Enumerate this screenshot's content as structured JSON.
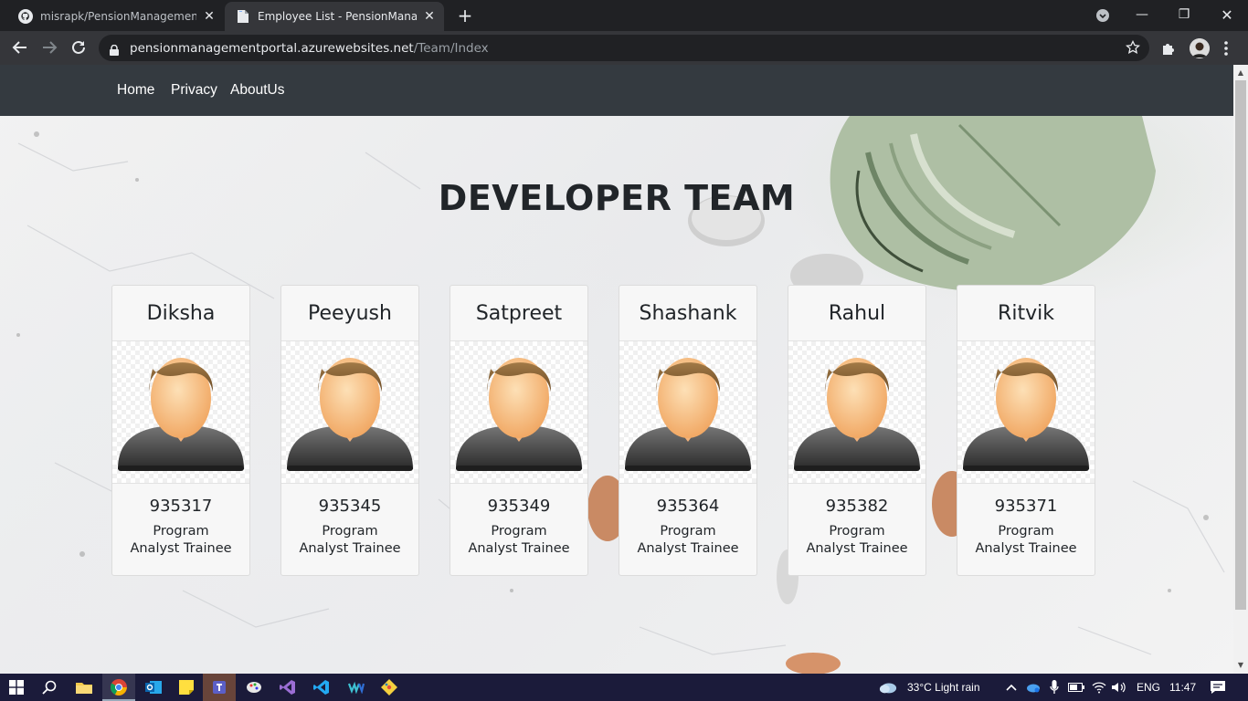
{
  "browser": {
    "tabs": [
      {
        "label": "misrapk/PensionManagement-Po",
        "active": false,
        "icon": "github-icon"
      },
      {
        "label": "Employee List - PensionManagem",
        "active": true,
        "icon": "document-icon"
      }
    ],
    "url_host": "pensionmanagementportal.azurewebsites.net",
    "url_path": "/Team/Index"
  },
  "nav": {
    "links": [
      "Home",
      "Privacy",
      "AboutUs"
    ]
  },
  "page": {
    "title": "DEVELOPER TEAM"
  },
  "team": [
    {
      "name": "Diksha",
      "id": "935317",
      "role_line1": "Program",
      "role_line2": "Analyst Trainee"
    },
    {
      "name": "Peeyush",
      "id": "935345",
      "role_line1": "Program",
      "role_line2": "Analyst Trainee"
    },
    {
      "name": "Satpreet",
      "id": "935349",
      "role_line1": "Program",
      "role_line2": "Analyst Trainee"
    },
    {
      "name": "Shashank",
      "id": "935364",
      "role_line1": "Program",
      "role_line2": "Analyst Trainee"
    },
    {
      "name": "Rahul",
      "id": "935382",
      "role_line1": "Program",
      "role_line2": "Analyst Trainee"
    },
    {
      "name": "Ritvik",
      "id": "935371",
      "role_line1": "Program",
      "role_line2": "Analyst Trainee"
    }
  ],
  "taskbar": {
    "weather": "33°C  Light rain",
    "language": "ENG",
    "time": "11:47"
  },
  "colors": {
    "navbar_bg": "#343a40",
    "browser_bg": "#202124",
    "taskbar_bg": "#1b1b3a"
  }
}
